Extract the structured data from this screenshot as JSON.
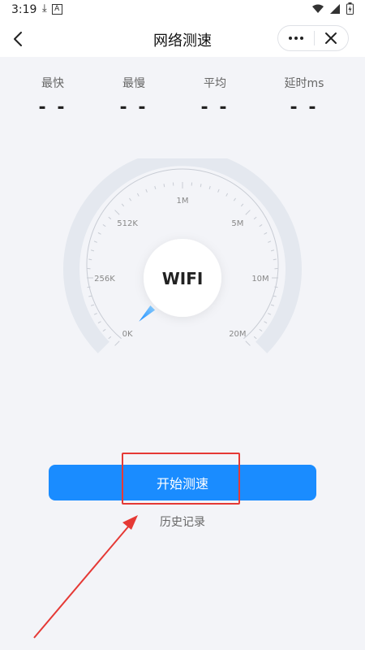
{
  "status_bar": {
    "time": "3:19",
    "icons": [
      "download-icon",
      "notification-a-icon",
      "wifi-icon",
      "signal-icon",
      "battery-icon"
    ]
  },
  "nav": {
    "title": "网络测速"
  },
  "stats": [
    {
      "label": "最快",
      "value": "- -"
    },
    {
      "label": "最慢",
      "value": "- -"
    },
    {
      "label": "平均",
      "value": "- -"
    },
    {
      "label": "延时ms",
      "value": "- -"
    }
  ],
  "gauge": {
    "center_label": "WIFI",
    "ticks": [
      "0K",
      "256K",
      "512K",
      "1M",
      "5M",
      "10M",
      "20M"
    ],
    "needle_level": 0
  },
  "actions": {
    "start_label": "开始测速",
    "history_label": "历史记录"
  },
  "colors": {
    "accent": "#1a8cff",
    "annotation": "#e53935",
    "background": "#f3f4f8"
  }
}
